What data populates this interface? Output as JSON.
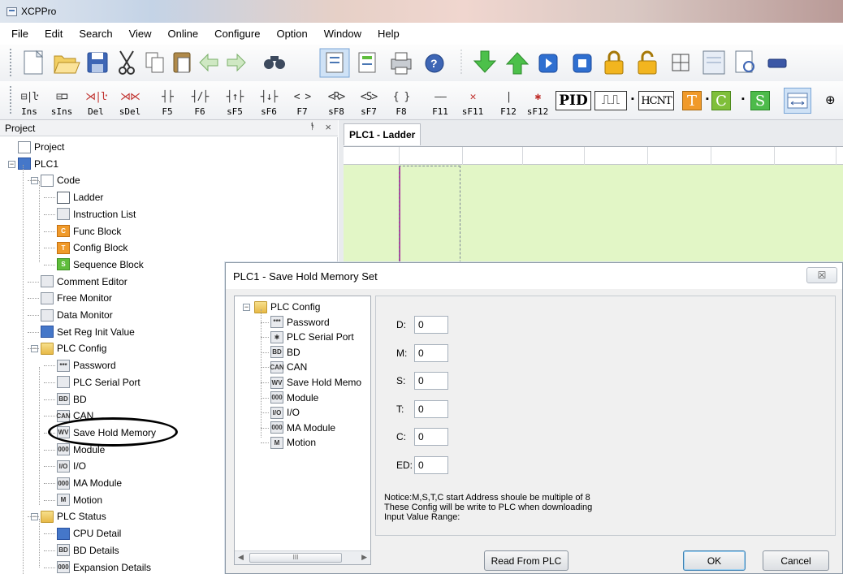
{
  "window": {
    "title": "XCPPro"
  },
  "menu": [
    "File",
    "Edit",
    "Search",
    "View",
    "Online",
    "Configure",
    "Option",
    "Window",
    "Help"
  ],
  "toolbar1": [
    "new-file-icon",
    "open-folder-icon",
    "save-icon",
    "cut-icon",
    "copy-icon",
    "paste-icon",
    "back-arrow-icon",
    "forward-arrow-icon",
    "find-icon",
    "ladder-view-icon",
    "list-view-icon",
    "print-icon",
    "help-icon",
    "download-icon",
    "upload-icon",
    "run-icon",
    "stop-icon",
    "lock-icon",
    "unlock-icon",
    "grid-icon",
    "preview-icon",
    "print-preview-icon",
    "serial-icon"
  ],
  "ladder_tools": [
    {
      "sym": "⊟|ŀ",
      "label": "Ins"
    },
    {
      "sym": "⊟⊐",
      "label": "sIns"
    },
    {
      "sym": "⋊|ŀ",
      "label": "Del",
      "red": true
    },
    {
      "sym": "⋊⋉",
      "label": "sDel",
      "red": true
    },
    {
      "sym": "┤├",
      "label": "F5"
    },
    {
      "sym": "┤/├",
      "label": "F6"
    },
    {
      "sym": "┤↑├",
      "label": "sF5"
    },
    {
      "sym": "┤↓├",
      "label": "sF6"
    },
    {
      "sym": "<  >",
      "label": "F7"
    },
    {
      "sym": "<R>",
      "label": "sF8"
    },
    {
      "sym": "<S>",
      "label": "sF7"
    },
    {
      "sym": "{  }",
      "label": "F8"
    },
    {
      "sym": "——",
      "label": "F11"
    },
    {
      "sym": "✕",
      "label": "sF11",
      "red": true
    },
    {
      "sym": "|",
      "label": "F12"
    },
    {
      "sym": "✱",
      "label": "sF12",
      "red": true
    }
  ],
  "ladder_tools_extra": {
    "pid": "PID",
    "pulse": "⎍⎍",
    "hcnt": "HCNT",
    "t": "T",
    "c": "C",
    "s": "S"
  },
  "project_panel": {
    "title": "Project",
    "pin": "ᚬ",
    "close": "×",
    "tree": [
      {
        "label": "Project",
        "level": 0,
        "icon": "project-icon"
      },
      {
        "label": "PLC1",
        "level": 0,
        "icon": "plc-icon",
        "expand": "−"
      },
      {
        "label": "Code",
        "level": 1,
        "icon": "code-icon",
        "expand": "−"
      },
      {
        "label": "Ladder",
        "level": 2,
        "icon": "ladder-icon"
      },
      {
        "label": "Instruction List",
        "level": 2,
        "icon": "instruction-list-icon"
      },
      {
        "label": "Func Block",
        "level": 2,
        "icon": "func-block-icon",
        "badge": "C"
      },
      {
        "label": "Config Block",
        "level": 2,
        "icon": "config-block-icon",
        "badge": "T"
      },
      {
        "label": "Sequence Block",
        "level": 2,
        "icon": "sequence-block-icon",
        "badge": "S"
      },
      {
        "label": "Comment Editor",
        "level": 1,
        "icon": "comment-editor-icon"
      },
      {
        "label": "Free Monitor",
        "level": 1,
        "icon": "free-monitor-icon"
      },
      {
        "label": "Data Monitor",
        "level": 1,
        "icon": "data-monitor-icon"
      },
      {
        "label": "Set Reg Init Value",
        "level": 1,
        "icon": "reg-init-icon"
      },
      {
        "label": "PLC Config",
        "level": 1,
        "icon": "folder-icon",
        "expand": "−"
      },
      {
        "label": "Password",
        "level": 2,
        "icon": "password-icon",
        "badge": "***"
      },
      {
        "label": "PLC Serial Port",
        "level": 2,
        "icon": "serial-port-icon"
      },
      {
        "label": "BD",
        "level": 2,
        "icon": "bd-icon",
        "badge": "BD"
      },
      {
        "label": "CAN",
        "level": 2,
        "icon": "can-icon",
        "badge": "CAN"
      },
      {
        "label": "Save Hold Memory",
        "level": 2,
        "icon": "save-hold-memory-icon",
        "badge": "WV"
      },
      {
        "label": "Module",
        "level": 2,
        "icon": "module-icon",
        "badge": "000"
      },
      {
        "label": "I/O",
        "level": 2,
        "icon": "io-icon",
        "badge": "I/O"
      },
      {
        "label": "MA Module",
        "level": 2,
        "icon": "ma-module-icon",
        "badge": "000"
      },
      {
        "label": "Motion",
        "level": 2,
        "icon": "motion-icon",
        "badge": "M"
      },
      {
        "label": "PLC Status",
        "level": 1,
        "icon": "folder-icon",
        "expand": "−"
      },
      {
        "label": "CPU Detail",
        "level": 2,
        "icon": "cpu-detail-icon"
      },
      {
        "label": "BD Details",
        "level": 2,
        "icon": "bd-details-icon",
        "badge": "BD"
      },
      {
        "label": "Expansion Details",
        "level": 2,
        "icon": "expansion-details-icon",
        "badge": "000"
      }
    ]
  },
  "doc_tab": "PLC1 - Ladder",
  "dialog": {
    "title": "PLC1 - Save Hold Memory  Set",
    "close": "☒",
    "tree": [
      {
        "label": "PLC Config",
        "level": 0,
        "icon": "folder-icon",
        "expand": "−"
      },
      {
        "label": "Password",
        "level": 1,
        "badge": "***"
      },
      {
        "label": "PLC Serial Port",
        "level": 1,
        "badge": "✱"
      },
      {
        "label": "BD",
        "level": 1,
        "badge": "BD"
      },
      {
        "label": "CAN",
        "level": 1,
        "badge": "CAN"
      },
      {
        "label": "Save Hold Memo",
        "level": 1,
        "badge": "WV"
      },
      {
        "label": "Module",
        "level": 1,
        "badge": "000"
      },
      {
        "label": "I/O",
        "level": 1,
        "badge": "I/O"
      },
      {
        "label": "MA Module",
        "level": 1,
        "badge": "000"
      },
      {
        "label": "Motion",
        "level": 1,
        "badge": "M"
      }
    ],
    "scroll_thumb": "III",
    "fields": [
      {
        "label": "D:",
        "value": "0"
      },
      {
        "label": "M:",
        "value": "0"
      },
      {
        "label": "S:",
        "value": "0"
      },
      {
        "label": "T:",
        "value": "0"
      },
      {
        "label": "C:",
        "value": "0"
      },
      {
        "label": "ED:",
        "value": "0"
      }
    ],
    "notice": [
      "Notice:M,S,T,C start Address shoule be  multiple of 8",
      "These Config will be write to PLC when downloading",
      "Input Value Range:"
    ],
    "buttons": {
      "read": "Read From PLC",
      "ok": "OK",
      "cancel": "Cancel"
    }
  }
}
